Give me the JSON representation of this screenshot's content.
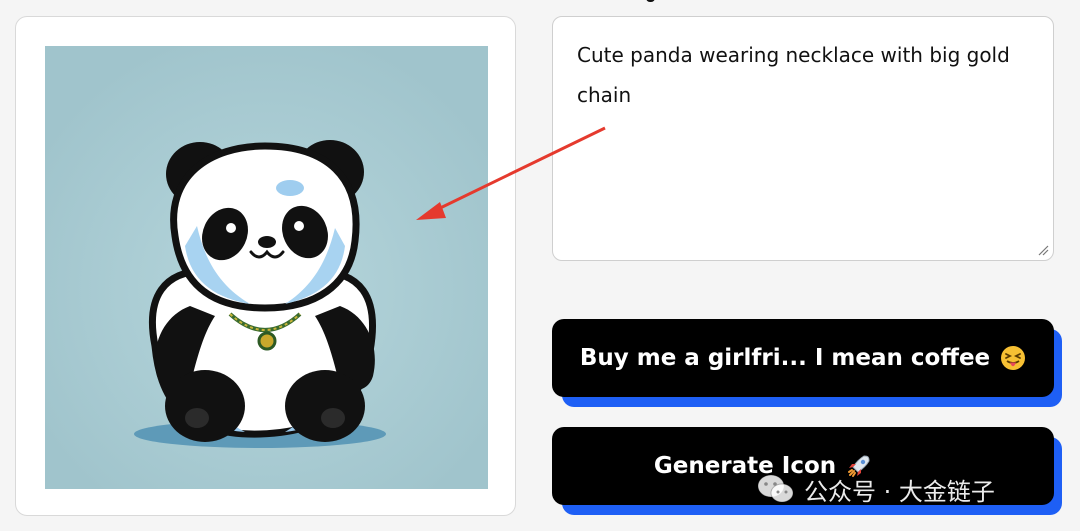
{
  "prompt": {
    "value": "Cute panda wearing necklace with big gold chain"
  },
  "buttons": {
    "coffee_label": "Buy me a girlfri... I mean coffee",
    "generate_label": "Generate Icon"
  },
  "watermark": {
    "text": "公众号 · 大金链子"
  },
  "icons": {
    "coffee_button_emoji": "squinting-tongue-face-emoji",
    "generate_button_emoji": "rocket-icon",
    "watermark_logo": "wechat-icon"
  },
  "colors": {
    "page_background": "#f5f5f5",
    "button_background": "#000000",
    "button_shadow": "#1e5ff5",
    "annotation_arrow": "#e53a2e",
    "image_background": "#a4c8d0"
  }
}
